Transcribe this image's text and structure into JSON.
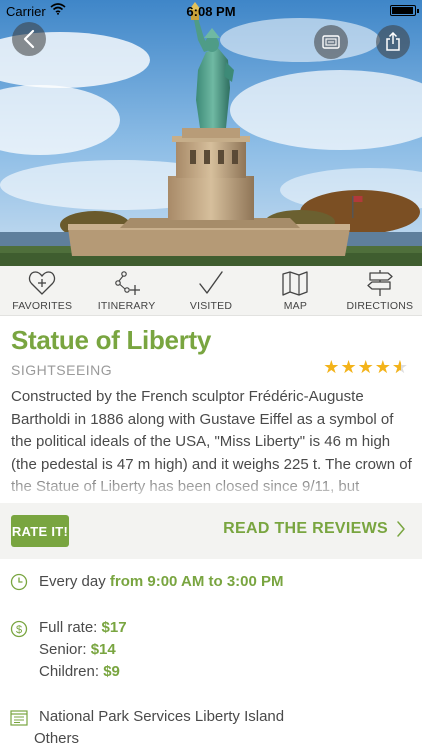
{
  "status_bar": {
    "carrier": "Carrier",
    "time": "6:08 PM"
  },
  "header_buttons": {
    "back_icon": "chevron-left-icon",
    "ticket_icon": "ticket-icon",
    "share_icon": "share-icon"
  },
  "actions": [
    {
      "label": "FAVORITES",
      "icon": "heart-plus-icon"
    },
    {
      "label": "ITINERARY",
      "icon": "route-icon"
    },
    {
      "label": "VISITED",
      "icon": "checkmark-icon"
    },
    {
      "label": "MAP",
      "icon": "map-icon"
    },
    {
      "label": "DIRECTIONS",
      "icon": "signpost-icon"
    }
  ],
  "place": {
    "title": "Statue of Liberty",
    "category": "SIGHTSEEING",
    "rating": 4.5,
    "rating_max": 5,
    "description": "Constructed by the French sculptor Frédéric-Auguste Bartholdi in 1886 along with Gustave Eiffel as a symbol of the political ideals of the USA, \"Miss Liberty\" is 46 m high (the pedestal is 47 m high) and it weighs 225 t. The crown of the Statue of Liberty has been closed since 9/11, but"
  },
  "rate": {
    "button_label": "RATE IT!",
    "reviews_label": "READ THE REVIEWS"
  },
  "hours": {
    "prefix": "Every day",
    "value": "from 9:00 AM to 3:00 PM"
  },
  "prices": [
    {
      "label": "Full rate:",
      "value": "$17"
    },
    {
      "label": "Senior:",
      "value": "$14"
    },
    {
      "label": "Children:",
      "value": "$9"
    }
  ],
  "venue": {
    "line1": "National Park Services Liberty Island",
    "line2": "Others"
  },
  "colors": {
    "accent": "#79a540",
    "star": "#f3b31a",
    "bar_bg": "#f3f3f1"
  }
}
